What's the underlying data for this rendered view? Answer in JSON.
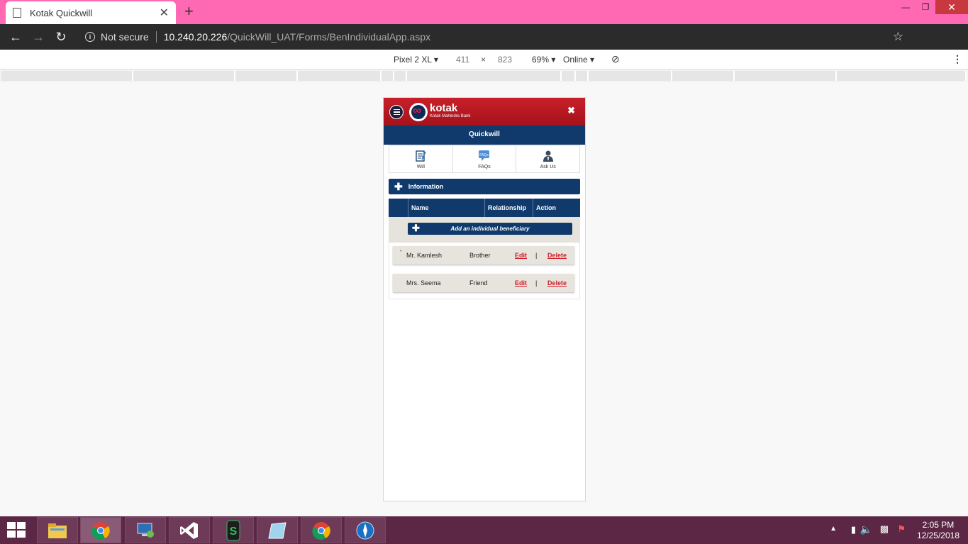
{
  "browser": {
    "tab_title": "Kotak Quickwill",
    "new_tab": "+",
    "close_tab": "✕",
    "security_label": "Not secure",
    "url_host": "10.240.20.226",
    "url_path": "/QuickWill_UAT/Forms/BenIndividualApp.aspx"
  },
  "devtools": {
    "device": "Pixel 2 XL",
    "width": "411",
    "times": "×",
    "height": "823",
    "zoom": "69%",
    "network": "Online"
  },
  "app": {
    "brand": "kotak",
    "brand_sub": "Kotak Mahindra Bank",
    "close": "✖",
    "title": "Quickwill",
    "nav": [
      {
        "label": "Will"
      },
      {
        "label": "FAQs",
        "badge": "FAQs"
      },
      {
        "label": "Ask Us"
      }
    ],
    "info_label": "Information",
    "table": {
      "headers": [
        "Name",
        "Relationship",
        "Action"
      ],
      "add_label": "Add an individual beneficiary",
      "rows": [
        {
          "name": "Mr. Kamlesh",
          "relationship": "Brother",
          "edit": "Edit",
          "divider": "|",
          "delete": "Delete"
        },
        {
          "name": "Mrs. Seema",
          "relationship": "Friend",
          "edit": "Edit",
          "divider": "|",
          "delete": "Delete"
        }
      ]
    }
  },
  "taskbar": {
    "time": "2:05 PM",
    "date": "12/25/2018"
  }
}
